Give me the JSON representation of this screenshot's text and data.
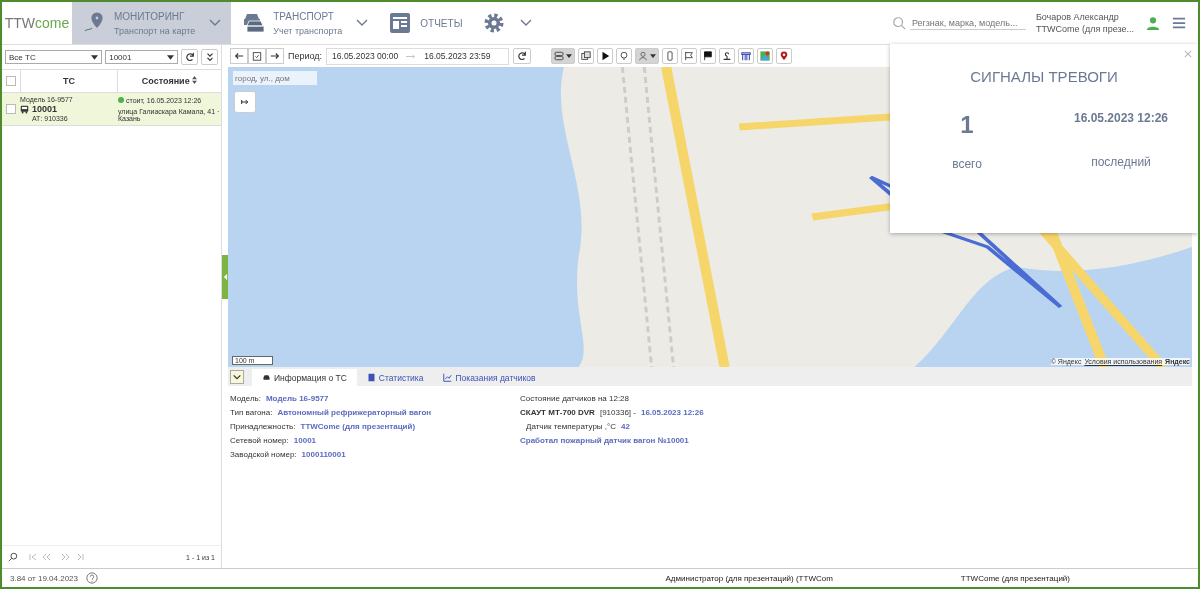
{
  "header": {
    "logo": {
      "part1": "TTW",
      "part2": "come"
    },
    "nav": [
      {
        "kind": "pin",
        "title": "МОНИТОРИНГ",
        "subtitle": "Транспорт на карте",
        "selected": true,
        "dropdown": true
      },
      {
        "kind": "cars",
        "title": "ТРАНСПОРТ",
        "subtitle": "Учет транспорта",
        "selected": false,
        "dropdown": true
      },
      {
        "kind": "report",
        "title": "ОТЧЕТЫ",
        "selected": false,
        "dropdown": false
      },
      {
        "kind": "gear",
        "selected": false,
        "dropdown": true
      }
    ],
    "search": {
      "placeholder": "Регзнак, марка, модель..."
    },
    "user": {
      "name": "Бочаров Александр",
      "org": "TTWCome (для презе..."
    }
  },
  "left": {
    "all_checked": false,
    "filter": "Все ТС",
    "vehicle": "10001",
    "columns": [
      "ТС",
      "Состояние"
    ],
    "rows": [
      {
        "model": "Модель 16-9577",
        "number": "10001",
        "at": "АТ: 910336",
        "status": "стоит, 16.05.2023 12:26",
        "address": "улица Галиаскара Камала, 41 · Казань",
        "color": "#4caf50",
        "checked": false,
        "selected": true
      }
    ],
    "pager": "1 - 1 из 1"
  },
  "toolbar": {
    "period_label": "Период:",
    "from": "16.05.2023 00:00",
    "to": "16.05.2023 23:59",
    "tools": [
      {
        "kind": "route",
        "selected": true,
        "dropdown": true
      },
      {
        "kind": "copy",
        "selected": false,
        "dropdown": false
      },
      {
        "kind": "play",
        "selected": false,
        "dropdown": false
      },
      {
        "kind": "bulb",
        "selected": false,
        "dropdown": false
      },
      {
        "kind": "person",
        "selected": true,
        "dropdown": true
      },
      {
        "kind": "phone",
        "selected": false,
        "dropdown": false
      },
      {
        "kind": "flag-outline",
        "selected": false,
        "dropdown": false
      },
      {
        "kind": "flag",
        "selected": false,
        "dropdown": false
      },
      {
        "kind": "sensor",
        "selected": false,
        "dropdown": false
      },
      {
        "kind": "gate",
        "selected": false,
        "dropdown": false
      },
      {
        "kind": "map",
        "selected": false,
        "dropdown": false
      },
      {
        "kind": "pin",
        "selected": false,
        "dropdown": false
      }
    ]
  },
  "map": {
    "search_placeholder": "город, ул., дом",
    "scale": "100 m",
    "attribution": "© Яндекс",
    "terms": "Условия использования",
    "brand": "Яндекс"
  },
  "alarm": {
    "title": "СИГНАЛЫ ТРЕВОГИ",
    "count": "1",
    "count_label": "всего",
    "last": "16.05.2023 12:26",
    "last_label": "последний"
  },
  "info": {
    "tabs": [
      {
        "kind": "car",
        "label": "Информация о ТС",
        "selected": true
      },
      {
        "kind": "book",
        "label": "Статистика",
        "selected": false
      },
      {
        "kind": "chart",
        "label": "Показания датчиков",
        "selected": false
      }
    ],
    "fields": [
      {
        "label": "Модель:",
        "value": "Модель 16-9577"
      },
      {
        "label": "Тип вагона:",
        "value": "Автономный рефрижераторный вагон"
      },
      {
        "label": "Принадлежность:",
        "value": "TTWCome (для презентаций)"
      },
      {
        "label": "Сетевой номер:",
        "value": "10001"
      },
      {
        "label": "Заводской номер:",
        "value": "1000110001"
      }
    ],
    "sensors": {
      "heading": "Состояние датчиков на 12:28",
      "device": "СКАУТ МТ-700 DVR",
      "device_id": "[910336] -",
      "device_time": "16.05.2023 12:26",
      "temp_label": "Датчик температуры ,°С",
      "temp_value": "42",
      "alarm": "Сработал пожарный датчик вагон №10001"
    }
  },
  "status_bar": {
    "version": "3.84 от 19.04.2023",
    "role": "Администратор (для презентаций) (TTWCom",
    "org": "TTWCome (для презентаций)"
  }
}
